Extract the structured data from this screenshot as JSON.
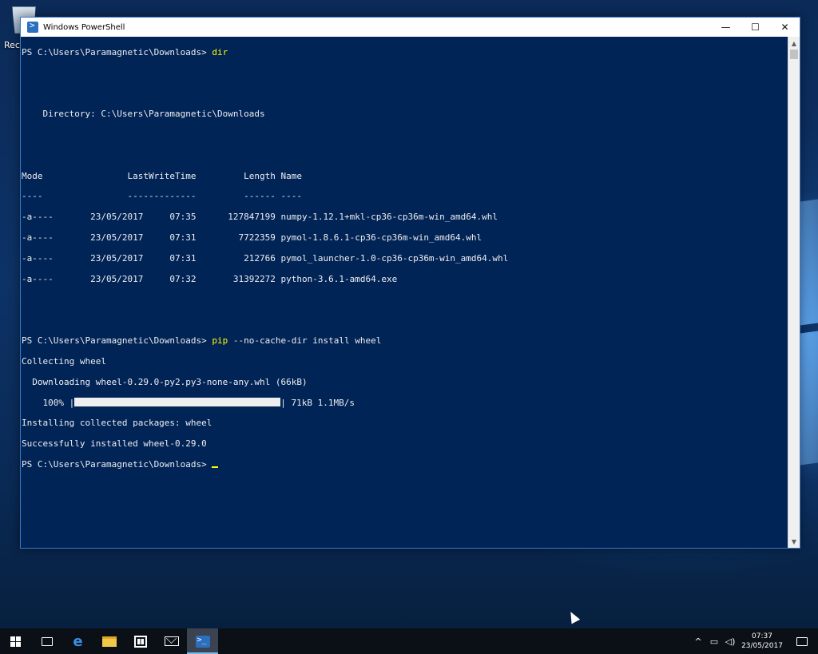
{
  "desktop": {
    "recycle_bin_label": "Recy"
  },
  "window": {
    "title": "Windows PowerShell",
    "controls": {
      "minimize": "—",
      "maximize": "☐",
      "close": "✕"
    }
  },
  "console": {
    "prompt": "PS C:\\Users\\Paramagnetic\\Downloads> ",
    "cmd1": "dir",
    "directory_line": "    Directory: C:\\Users\\Paramagnetic\\Downloads",
    "header": "Mode                LastWriteTime         Length Name",
    "header_rule": "----                -------------         ------ ----",
    "files": [
      {
        "mode": "-a----",
        "date": "23/05/2017",
        "time": "07:35",
        "length": "127847199",
        "name": "numpy-1.12.1+mkl-cp36-cp36m-win_amd64.whl"
      },
      {
        "mode": "-a----",
        "date": "23/05/2017",
        "time": "07:31",
        "length": "7722359",
        "name": "pymol-1.8.6.1-cp36-cp36m-win_amd64.whl"
      },
      {
        "mode": "-a----",
        "date": "23/05/2017",
        "time": "07:31",
        "length": "212766",
        "name": "pymol_launcher-1.0-cp36-cp36m-win_amd64.whl"
      },
      {
        "mode": "-a----",
        "date": "23/05/2017",
        "time": "07:32",
        "length": "31392272",
        "name": "python-3.6.1-amd64.exe"
      }
    ],
    "file_lines": [
      "-a----       23/05/2017     07:35      127847199 numpy-1.12.1+mkl-cp36-cp36m-win_amd64.whl",
      "-a----       23/05/2017     07:31        7722359 pymol-1.8.6.1-cp36-cp36m-win_amd64.whl",
      "-a----       23/05/2017     07:31         212766 pymol_launcher-1.0-cp36-cp36m-win_amd64.whl",
      "-a----       23/05/2017     07:32       31392272 python-3.6.1-amd64.exe"
    ],
    "cmd2_exe": "pip",
    "cmd2_args": " --no-cache-dir install wheel",
    "collecting": "Collecting wheel",
    "downloading": "  Downloading wheel-0.29.0-py2.py3-none-any.whl (66kB)",
    "progress_prefix": "    100% |",
    "progress_suffix": "| 71kB 1.1MB/s",
    "progress_fraction": 1.0,
    "installing": "Installing collected packages: wheel",
    "success": "Successfully installed wheel-0.29.0"
  },
  "taskbar": {
    "items": [
      "start-button",
      "task-view-button",
      "edge-button",
      "file-explorer-button",
      "store-button",
      "mail-button",
      "powershell-button"
    ],
    "active_item": "powershell-button",
    "tray": {
      "chevron": "^",
      "time": "07:37",
      "date": "23/05/2017"
    }
  },
  "colors": {
    "console_bg": "#012456",
    "console_fg": "#eeedf0",
    "command_color": "#ffff00",
    "taskbar_bg": "#0b0f16"
  }
}
